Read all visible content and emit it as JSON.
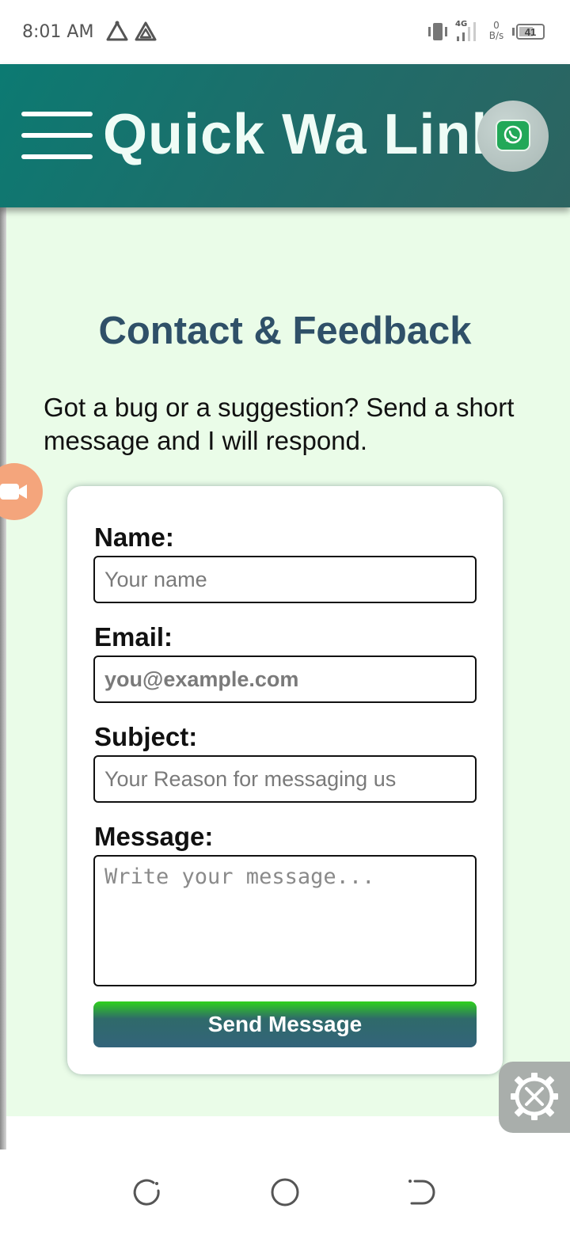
{
  "status_bar": {
    "time": "8:01 AM",
    "network_value": "0",
    "network_unit": "B/s",
    "network_type": "4G",
    "battery": "41",
    "icons": [
      "triangle-outline-icon",
      "drive-icon",
      "vibrate-icon",
      "signal-icon",
      "battery-icon"
    ]
  },
  "header": {
    "title": "Quick Wa Link",
    "menu_icon": "hamburger-menu-icon",
    "logo_icon": "whatsapp-icon"
  },
  "main": {
    "title": "Contact & Feedback",
    "intro": "Got a bug or a suggestion? Send a short message and I will respond."
  },
  "form": {
    "name_label": "Name:",
    "name_placeholder": "Your name",
    "email_label": "Email:",
    "email_placeholder": "you@example.com",
    "subject_label": "Subject:",
    "subject_placeholder": "Your Reason for messaging us",
    "message_label": "Message:",
    "message_placeholder": "Write your message...",
    "submit_label": "Send Message"
  },
  "floating": {
    "record_icon": "video-camera-icon",
    "tools_icon": "gear-tools-icon"
  },
  "nav": {
    "icons": [
      "recents-icon",
      "home-icon",
      "back-icon"
    ]
  },
  "colors": {
    "header": "#1e6d6a",
    "background": "#eafce8",
    "title": "#2f5068",
    "button": "#33647a",
    "button_top": "#2fd11c"
  }
}
